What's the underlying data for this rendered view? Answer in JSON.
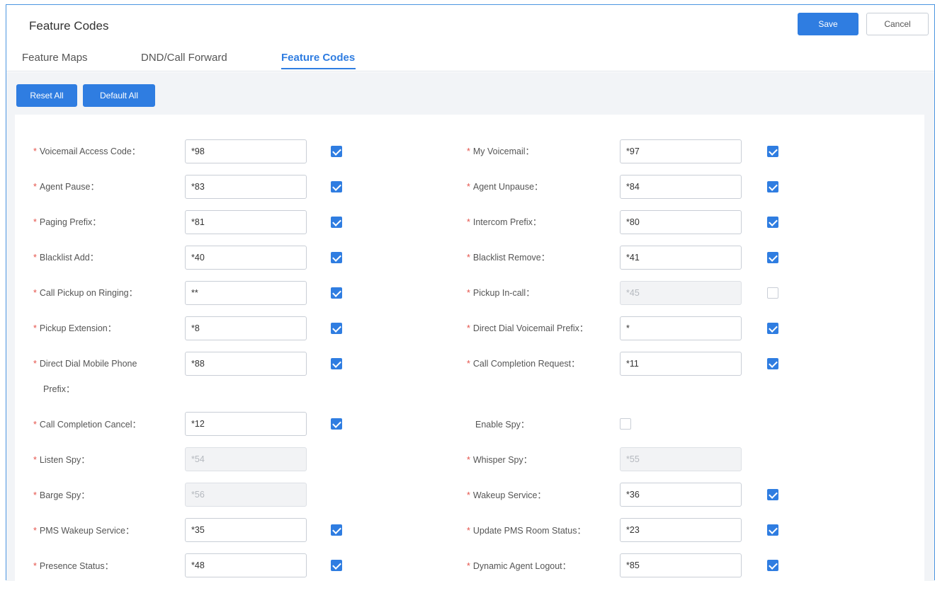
{
  "header": {
    "title": "Feature Codes",
    "save_label": "Save",
    "cancel_label": "Cancel"
  },
  "tabs": [
    {
      "label": "Feature Maps",
      "active": false
    },
    {
      "label": "DND/Call Forward",
      "active": false
    },
    {
      "label": "Feature Codes",
      "active": true
    }
  ],
  "toolbar": {
    "reset_all_label": "Reset All",
    "default_all_label": "Default All"
  },
  "fields": {
    "voicemail_access_code": {
      "label": "Voicemail Access Code：",
      "value": "*98",
      "required": true,
      "enabled": true
    },
    "my_voicemail": {
      "label": "My Voicemail：",
      "value": "*97",
      "required": true,
      "enabled": true
    },
    "agent_pause": {
      "label": "Agent Pause：",
      "value": "*83",
      "required": true,
      "enabled": true
    },
    "agent_unpause": {
      "label": "Agent Unpause：",
      "value": "*84",
      "required": true,
      "enabled": true
    },
    "paging_prefix": {
      "label": "Paging Prefix：",
      "value": "*81",
      "required": true,
      "enabled": true
    },
    "intercom_prefix": {
      "label": "Intercom Prefix：",
      "value": "*80",
      "required": true,
      "enabled": true
    },
    "blacklist_add": {
      "label": "Blacklist Add：",
      "value": "*40",
      "required": true,
      "enabled": true
    },
    "blacklist_remove": {
      "label": "Blacklist Remove：",
      "value": "*41",
      "required": true,
      "enabled": true
    },
    "call_pickup_on_ringing": {
      "label": "Call Pickup on Ringing：",
      "value": "**",
      "required": true,
      "enabled": true
    },
    "pickup_in_call": {
      "label": "Pickup In-call：",
      "value": "*45",
      "required": true,
      "enabled": false
    },
    "pickup_extension": {
      "label": "Pickup Extension：",
      "value": "*8",
      "required": true,
      "enabled": true
    },
    "direct_dial_voicemail_prefix": {
      "label": "Direct Dial Voicemail Prefix：",
      "value": "*",
      "required": true,
      "enabled": true
    },
    "direct_dial_mobile_phone_prefix": {
      "label_line1": "Direct Dial Mobile Phone",
      "label_line2": "Prefix：",
      "value": "*88",
      "required": true,
      "enabled": true
    },
    "call_completion_request": {
      "label": "Call Completion Request：",
      "value": "*11",
      "required": true,
      "enabled": true
    },
    "call_completion_cancel": {
      "label": "Call Completion Cancel：",
      "value": "*12",
      "required": true,
      "enabled": true
    },
    "enable_spy": {
      "label": "Enable Spy：",
      "enabled": false
    },
    "listen_spy": {
      "label": "Listen Spy：",
      "value": "*54",
      "required": true
    },
    "whisper_spy": {
      "label": "Whisper Spy：",
      "value": "*55",
      "required": true
    },
    "barge_spy": {
      "label": "Barge Spy：",
      "value": "*56",
      "required": true
    },
    "wakeup_service": {
      "label": "Wakeup Service：",
      "value": "*36",
      "required": true,
      "enabled": true
    },
    "pms_wakeup_service": {
      "label": "PMS Wakeup Service：",
      "value": "*35",
      "required": true,
      "enabled": true
    },
    "update_pms_room_status": {
      "label": "Update PMS Room Status：",
      "value": "*23",
      "required": true,
      "enabled": true
    },
    "presence_status": {
      "label": "Presence Status：",
      "value": "*48",
      "required": true,
      "enabled": true
    },
    "dynamic_agent_logout": {
      "label": "Dynamic Agent Logout：",
      "value": "*85",
      "required": true,
      "enabled": true
    }
  },
  "required_marker": "*",
  "colors": {
    "accent": "#2f7de1",
    "required": "#e5534b",
    "frame_border": "#4c95e0",
    "page_background": "#f2f4f7"
  }
}
